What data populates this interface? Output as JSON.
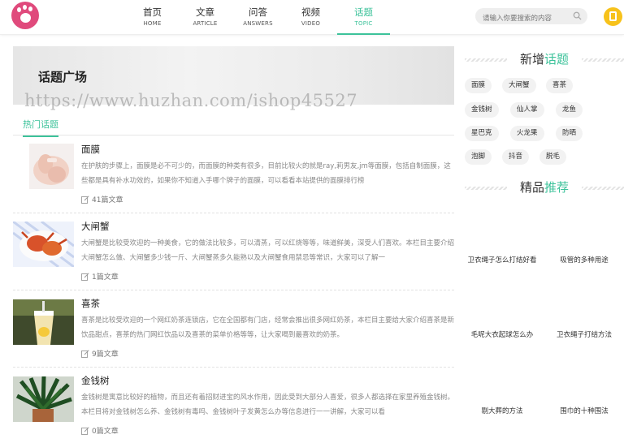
{
  "header": {
    "nav": [
      {
        "zh": "首页",
        "en": "HOME"
      },
      {
        "zh": "文章",
        "en": "ARTICLE"
      },
      {
        "zh": "问答",
        "en": "ANSWERS"
      },
      {
        "zh": "视频",
        "en": "VIDEO"
      },
      {
        "zh": "话题",
        "en": "TOPIC",
        "active": true
      }
    ],
    "search_placeholder": "请输入你要搜索的内容"
  },
  "banner": {
    "title": "话题广场",
    "watermark": "https://www.huzhan.com/ishop45527"
  },
  "tabs": {
    "hot": "热门话题"
  },
  "topics": [
    {
      "name": "面膜",
      "desc": "在护肤的步骤上，面膜是必不可少的，而面膜的种类有很多，目前比较火的就是ray,莉男友,jm等面膜，包括自制面膜，这些都是具有补水功效的，如果你不知道入手哪个牌子的面膜，可以看看本站提供的面膜排行榜",
      "count": "41篇文章"
    },
    {
      "name": "大闸蟹",
      "desc": "大闸蟹是比较受欢迎的一种美食，它的做法比较多，可以清蒸，可以红烧等等，味道鲜美，深受人们喜欢。本栏目主要介绍大闸蟹怎么做、大闸蟹多少钱一斤、大闸蟹蒸多久能熟以及大闸蟹食用禁忌等常识，大家可以了解一",
      "count": "1篇文章"
    },
    {
      "name": "喜茶",
      "desc": "喜茶是比较受欢迎的一个网红奶茶连锁店，它在全国都有门店，经常会推出很多网红奶茶，本栏目主要给大家介绍喜茶是新饮品甜点，喜茶的热门网红饮品以及喜茶的菜单价格等等，让大家喝到最喜欢的奶茶。",
      "count": "9篇文章"
    },
    {
      "name": "金钱树",
      "desc": "金钱树是寓意比较好的植物，而且还有着招财进宝的风水作用，因此受到大部分人喜爱，很多人都选择在家里养殖金钱树。本栏目将对金钱树怎么养、金钱树有毒吗、金钱树叶子发黄怎么办等信息进行一一讲解，大家可以看",
      "count": "0篇文章"
    }
  ],
  "sidebar": {
    "new_topics_title_a": "新增",
    "new_topics_title_b": "话题",
    "tags": [
      "面膜",
      "大闸蟹",
      "喜茶",
      "金钱树",
      "仙人掌",
      "龙鱼",
      "星巴克",
      "火龙果",
      "防晒",
      "泡脚",
      "抖音",
      "脱毛"
    ],
    "featured_title_a": "精品",
    "featured_title_b": "推荐",
    "featured": [
      "卫衣绳子怎么打结好看",
      "吸管的多种用途",
      "毛呢大衣起球怎么办",
      "卫衣绳子打结方法",
      "剔大葬的方法",
      "围巾的十种围法"
    ]
  },
  "colors": {
    "accent": "#3cc29a",
    "logo": "#e04a7c",
    "user": "#f7c21b"
  }
}
